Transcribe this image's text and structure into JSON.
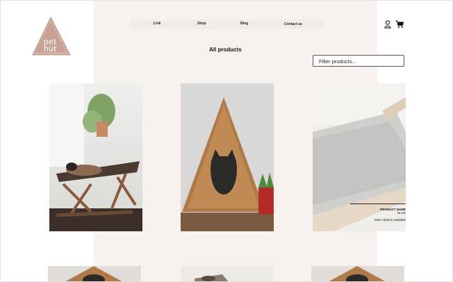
{
  "brand": {
    "logo_text": "pet hut"
  },
  "nav": {
    "items": [
      "Link",
      "Shop",
      "Blog",
      "Contact us"
    ]
  },
  "header_icons": [
    "user-icon",
    "cart-icon"
  ],
  "page": {
    "title": "All products"
  },
  "filter": {
    "placeholder": "Filter products..."
  },
  "products": [
    {
      "image": "cat-hammock-bed-photo"
    },
    {
      "image": "wooden-triangle-cat-house-photo"
    },
    {
      "image": "wooden-pet-bed-photo",
      "overlay": {
        "name": "PRODUCT NAME",
        "price": "n£ XX",
        "more": "More options available"
      }
    }
  ],
  "products_row2": [
    {
      "image": "wooden-cat-house-photo"
    },
    {
      "image": "cat-on-bed-photo"
    },
    {
      "image": "wooden-cat-house-photo"
    }
  ],
  "colors": {
    "accent": "#c9a899",
    "band": "#f8f2ee"
  }
}
